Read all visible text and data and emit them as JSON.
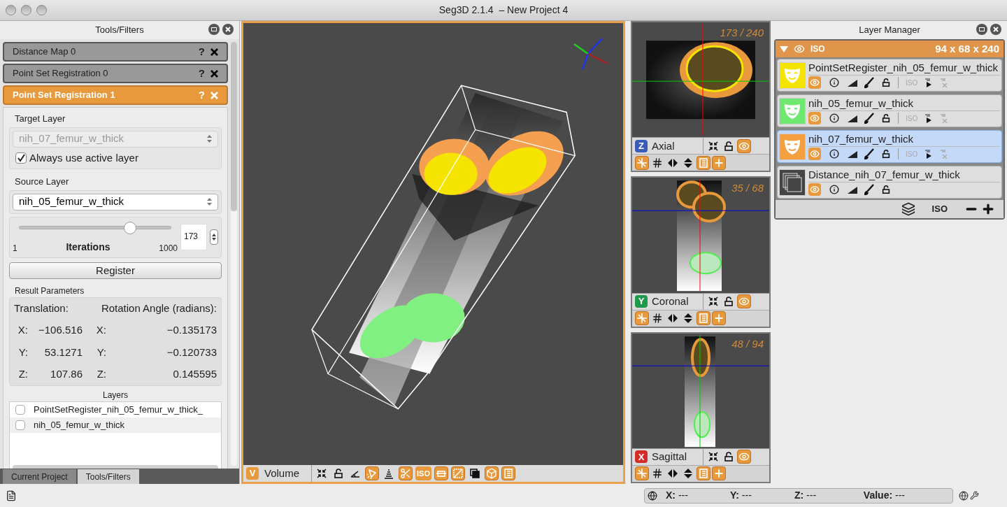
{
  "window": {
    "title": "Seg3D 2.1.4  – New Project 4"
  },
  "tools_panel": {
    "title": "Tools/Filters",
    "tools": [
      {
        "title": "Distance Map 0",
        "help": "?",
        "active": false
      },
      {
        "title": "Point Set Registration 0",
        "help": "?",
        "active": false
      },
      {
        "title": "Point Set Registration 1",
        "help": "?",
        "active": true
      }
    ],
    "target_layer": {
      "label": "Target Layer",
      "value": "nih_07_femur_w_thick",
      "disabled": true
    },
    "use_active": {
      "label": "Always use active layer",
      "checked": true
    },
    "source_layer": {
      "label": "Source Layer",
      "value": "nih_05_femur_w_thick",
      "disabled": false
    },
    "iterations": {
      "label": "Iterations",
      "min": "1",
      "max": "1000",
      "level": 0.73,
      "value": "173"
    },
    "register_button": "Register",
    "results": {
      "title": "Result Parameters",
      "translation_heading": "Translation:",
      "rotation_heading": "Rotation Angle (radians):",
      "rows": [
        {
          "t_axis": "X:",
          "t_value": "−106.516",
          "r_axis": "X:",
          "r_value": "−0.135173"
        },
        {
          "t_axis": "Y:",
          "t_value": "53.1271",
          "r_axis": "Y:",
          "r_value": "−0.120733"
        },
        {
          "t_axis": "Z:",
          "t_value": "107.86",
          "r_axis": "Z:",
          "r_value": "0.145595"
        }
      ]
    },
    "layers": {
      "title": "Layers",
      "items": [
        {
          "name": "PointSetRegister_nih_05_femur_w_thick_",
          "checked": false
        },
        {
          "name": "nih_05_femur_w_thick",
          "checked": false
        }
      ]
    },
    "tabs": [
      {
        "label": "Current Project",
        "selected": false
      },
      {
        "label": "Tools/Filters",
        "selected": true
      }
    ]
  },
  "volume_view": {
    "badge": "V",
    "color": "#e8993c",
    "label": "Volume",
    "toolbar": [
      {
        "kind": "fit",
        "on": false
      },
      {
        "kind": "lock",
        "on": false
      },
      {
        "kind": "ruler",
        "on": false
      },
      {
        "kind": "light",
        "on": true
      },
      {
        "kind": "stack",
        "on": false
      },
      {
        "kind": "scissors",
        "on": true
      },
      {
        "kind": "iso",
        "label": "ISO",
        "on": true
      },
      {
        "kind": "frame",
        "on": true
      },
      {
        "kind": "diagonal",
        "on": true
      },
      {
        "kind": "layers",
        "on": false
      },
      {
        "kind": "cube",
        "on": true
      },
      {
        "kind": "doc",
        "on": true
      }
    ]
  },
  "slice_views": [
    {
      "kind": "axial",
      "badge": "Z",
      "color": "#3a5cb8",
      "label": "Axial",
      "slice": "173 / 240",
      "toolbar_top": [
        {
          "kind": "fit",
          "on": false
        },
        {
          "kind": "lock",
          "on": false
        },
        {
          "kind": "eye",
          "on": true
        }
      ],
      "toolbar_bottom": [
        {
          "kind": "pick",
          "on": true
        },
        {
          "kind": "grid",
          "on": false
        },
        {
          "kind": "fliph",
          "on": false
        },
        {
          "kind": "flipv",
          "on": false
        },
        {
          "kind": "doc",
          "on": true
        },
        {
          "kind": "plus",
          "on": true
        }
      ]
    },
    {
      "kind": "coronal",
      "badge": "Y",
      "color": "#1f9a4a",
      "label": "Coronal",
      "slice": "35 / 68",
      "toolbar_top": [
        {
          "kind": "fit",
          "on": false
        },
        {
          "kind": "lock",
          "on": false
        },
        {
          "kind": "eye",
          "on": true
        }
      ],
      "toolbar_bottom": [
        {
          "kind": "pick",
          "on": true
        },
        {
          "kind": "grid",
          "on": false
        },
        {
          "kind": "fliph",
          "on": false
        },
        {
          "kind": "flipv",
          "on": false
        },
        {
          "kind": "doc",
          "on": true
        },
        {
          "kind": "plus",
          "on": true
        }
      ]
    },
    {
      "kind": "sagittal",
      "badge": "X",
      "color": "#d42b2b",
      "label": "Sagittal",
      "slice": "48 / 94",
      "toolbar_top": [
        {
          "kind": "fit",
          "on": false
        },
        {
          "kind": "lock",
          "on": false
        },
        {
          "kind": "eye",
          "on": true
        }
      ],
      "toolbar_bottom": [
        {
          "kind": "pick",
          "on": true
        },
        {
          "kind": "grid",
          "on": false
        },
        {
          "kind": "fliph",
          "on": false
        },
        {
          "kind": "flipv",
          "on": false
        },
        {
          "kind": "doc",
          "on": true
        },
        {
          "kind": "plus",
          "on": true
        }
      ]
    }
  ],
  "layer_manager": {
    "title": "Layer Manager",
    "group": {
      "expanded": true,
      "iso_label": "ISO",
      "size": "94 x 68 x 240"
    },
    "layers": [
      {
        "name": "PointSetRegister_nih_05_femur_w_thick",
        "kind": "mask",
        "color": "#f5e400",
        "selected": false,
        "visible": true,
        "iso_label": "ISO"
      },
      {
        "name": "nih_05_femur_w_thick",
        "kind": "mask",
        "color": "#6ee86e",
        "selected": false,
        "visible": true,
        "iso_label": "ISO"
      },
      {
        "name": "nih_07_femur_w_thick",
        "kind": "mask",
        "color": "#f5a040",
        "selected": true,
        "visible": true,
        "iso_label": "ISO"
      },
      {
        "name": "Distance_nih_07_femur_w_thick",
        "kind": "data",
        "color": "#444444",
        "selected": false,
        "visible": true
      }
    ],
    "footer": {
      "iso_label": "ISO"
    }
  },
  "status_bar": {
    "coords": [
      {
        "label": "X:",
        "value": "---"
      },
      {
        "label": "Y:",
        "value": "---"
      },
      {
        "label": "Z:",
        "value": "---"
      },
      {
        "label": "Value:",
        "value": "---"
      }
    ]
  }
}
